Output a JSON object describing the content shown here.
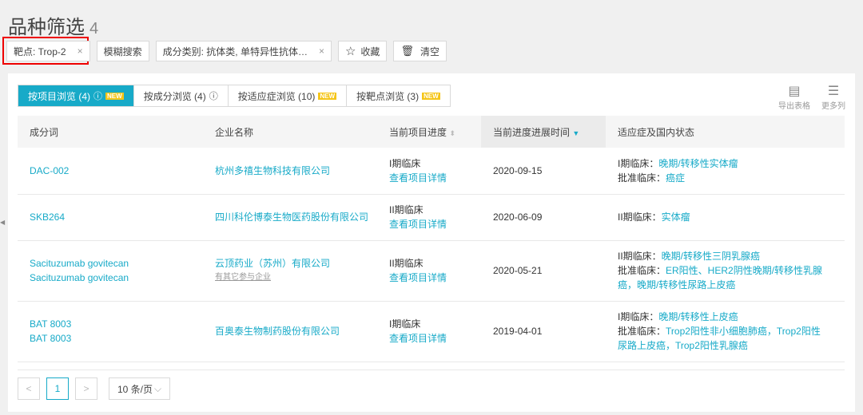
{
  "title": "品种筛选",
  "count": "4",
  "filters": {
    "target": "靶点: Trop-2",
    "fuzzy": "模糊搜索",
    "category": "成分类别: 抗体类, 单特异性抗体…",
    "favorite": "收藏",
    "clear": "清空",
    "close": "×"
  },
  "tabs": [
    {
      "label": "按项目浏览 (4)",
      "new": "NEW",
      "help": true
    },
    {
      "label": "按成分浏览 (4)"
    },
    {
      "label": "按适应症浏览 (10)",
      "new": "NEW"
    },
    {
      "label": "按靶点浏览 (3)",
      "new": "NEW"
    }
  ],
  "new_badge": "NEW",
  "tools": {
    "export": "导出表格",
    "more": "更多列"
  },
  "columns": [
    "成分词",
    "企业名称",
    "当前项目进度",
    "当前进度进展时间",
    "适应症及国内状态"
  ],
  "rows": [
    {
      "names": [
        "DAC-002"
      ],
      "company": "杭州多禧生物科技有限公司",
      "sub": "",
      "stage": "I期临床",
      "detail": "查看项目详情",
      "date": "2020-09-15",
      "ind": [
        {
          "k": "I期临床：",
          "v": "晚期/转移性实体瘤"
        },
        {
          "k": "批准临床：",
          "v": "癌症"
        }
      ]
    },
    {
      "names": [
        "SKB264"
      ],
      "company": "四川科伦博泰生物医药股份有限公司",
      "sub": "",
      "stage": "II期临床",
      "detail": "查看项目详情",
      "date": "2020-06-09",
      "ind": [
        {
          "k": "II期临床：",
          "v": "实体瘤"
        }
      ]
    },
    {
      "names": [
        "Sacituzumab govitecan",
        "Sacituzumab govitecan"
      ],
      "company": "云顶药业（苏州）有限公司",
      "sub": "有其它参与企业",
      "stage": "II期临床",
      "detail": "查看项目详情",
      "date": "2020-05-21",
      "ind": [
        {
          "k": "II期临床：",
          "v": "晚期/转移性三阴乳腺癌"
        },
        {
          "k": "批准临床：",
          "v": "ER阳性、HER2阴性晚期/转移性乳腺癌，晚期/转移性尿路上皮癌"
        }
      ]
    },
    {
      "names": [
        "BAT 8003",
        "BAT 8003"
      ],
      "company": "百奥泰生物制药股份有限公司",
      "sub": "",
      "stage": "I期临床",
      "detail": "查看项目详情",
      "date": "2019-04-01",
      "ind": [
        {
          "k": "I期临床：",
          "v": "晚期/转移性上皮癌"
        },
        {
          "k": "批准临床：",
          "v": "Trop2阳性非小细胞肺癌，Trop2阳性尿路上皮癌，Trop2阳性乳腺癌"
        }
      ]
    }
  ],
  "pager": {
    "prev": "<",
    "page": "1",
    "next": ">",
    "size": "10 条/页"
  }
}
